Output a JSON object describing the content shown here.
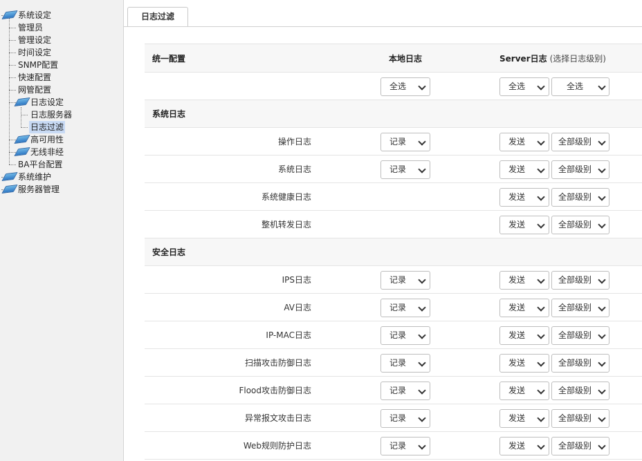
{
  "sidebar": {
    "items": [
      {
        "label": "系统设定",
        "icon": "folder-open-icon"
      },
      {
        "label": "管理员"
      },
      {
        "label": "管理设定"
      },
      {
        "label": "时间设定"
      },
      {
        "label": "SNMP配置"
      },
      {
        "label": "快速配置"
      },
      {
        "label": "网管配置"
      },
      {
        "label": "日志设定",
        "icon": "folder-open-icon"
      },
      {
        "label": "日志服务器"
      },
      {
        "label": "日志过滤",
        "selected": true
      },
      {
        "label": "高可用性",
        "icon": "folder-icon"
      },
      {
        "label": "无线非经",
        "icon": "folder-icon"
      },
      {
        "label": "BA平台配置"
      },
      {
        "label": "系统维护",
        "icon": "folder-icon"
      },
      {
        "label": "服务器管理",
        "icon": "folder-icon"
      }
    ]
  },
  "tab": {
    "label": "日志过滤"
  },
  "table": {
    "header": {
      "title": "统一配置",
      "local": "本地日志",
      "server": "Server日志",
      "server_hint": "(选择日志级别)"
    },
    "unified": {
      "local": "全选",
      "server": "全选",
      "level": "全选"
    },
    "sections": [
      {
        "title": "系统日志",
        "rows": [
          {
            "label": "操作日志",
            "local": "记录",
            "server": "发送",
            "level": "全部级别"
          },
          {
            "label": "系统日志",
            "local": "记录",
            "server": "发送",
            "level": "全部级别"
          },
          {
            "label": "系统健康日志",
            "server": "发送",
            "level": "全部级别"
          },
          {
            "label": "整机转发日志",
            "server": "发送",
            "level": "全部级别"
          }
        ]
      },
      {
        "title": "安全日志",
        "rows": [
          {
            "label": "IPS日志",
            "local": "记录",
            "server": "发送",
            "level": "全部级别"
          },
          {
            "label": "AV日志",
            "local": "记录",
            "server": "发送",
            "level": "全部级别"
          },
          {
            "label": "IP-MAC日志",
            "local": "记录",
            "server": "发送",
            "level": "全部级别"
          },
          {
            "label": "扫描攻击防御日志",
            "local": "记录",
            "server": "发送",
            "level": "全部级别"
          },
          {
            "label": "Flood攻击防御日志",
            "local": "记录",
            "server": "发送",
            "level": "全部级别"
          },
          {
            "label": "异常报文攻击日志",
            "local": "记录",
            "server": "发送",
            "level": "全部级别"
          },
          {
            "label": "Web规则防护日志",
            "local": "记录",
            "server": "发送",
            "level": "全部级别"
          }
        ]
      }
    ]
  }
}
